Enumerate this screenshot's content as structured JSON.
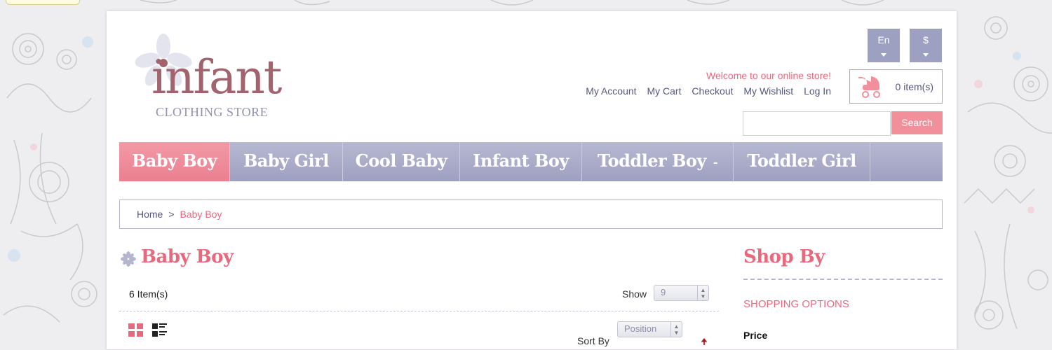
{
  "logo": {
    "word": "infant",
    "subtitle": "CLOTHING STORE"
  },
  "header": {
    "language": "En",
    "currency": "$",
    "welcome": "Welcome to our online store!",
    "links": [
      "My Account",
      "My Cart",
      "Checkout",
      "My Wishlist",
      "Log In"
    ],
    "cart_count": "0 item(s)",
    "search_value": "",
    "search_button": "Search"
  },
  "nav": {
    "items": [
      {
        "label": "Baby Boy",
        "active": true
      },
      {
        "label": "Baby Girl",
        "active": false
      },
      {
        "label": "Cool Baby",
        "active": false
      },
      {
        "label": "Infant Boy",
        "active": false
      },
      {
        "label": "Toddler Boy",
        "active": false,
        "has_dropdown": true,
        "caret": "-"
      },
      {
        "label": "Toddler Girl",
        "active": false
      }
    ]
  },
  "breadcrumb": {
    "home": "Home",
    "separator": ">",
    "current": "Baby Boy"
  },
  "category": {
    "title": "Baby Boy",
    "item_count": "6 Item(s)",
    "show_label": "Show",
    "show_value": "9",
    "sort_label": "Sort By",
    "sort_value": "Position",
    "sort_direction_icon": "sort-ascending-arrow"
  },
  "sidebar": {
    "title": "Shop By",
    "options_heading": "SHOPPING OPTIONS",
    "price_label": "Price"
  },
  "colors": {
    "accent_pink": "#e8687d",
    "nav_purple": "#9ea0c0",
    "logo_mauve": "#a2636e",
    "link_text": "#56587e"
  },
  "icons": [
    "flower-logo-icon",
    "pram-icon",
    "caret-down-icon",
    "star-flower-icon",
    "grid-view-icon",
    "list-view-icon"
  ]
}
